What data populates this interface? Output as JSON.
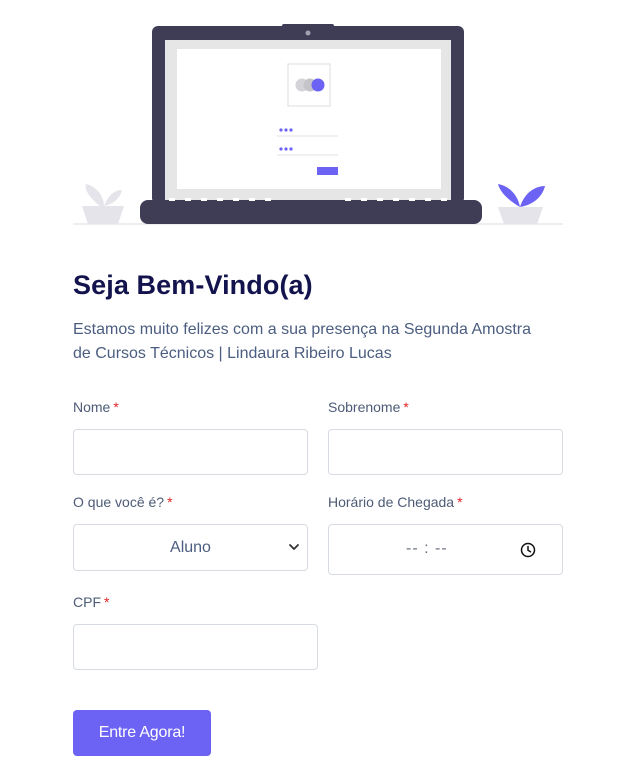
{
  "illustration": {
    "name": "laptop-login-illustration",
    "accent_color": "#6c63f5",
    "dark_color": "#3f3d56"
  },
  "header": {
    "title": "Seja Bem-Vindo(a)",
    "subtitle_line1": "Estamos muito felizes com a sua presença na Segunda Amostra",
    "subtitle_line2": "de Cursos Técnicos | Lindaura Ribeiro Lucas"
  },
  "form": {
    "required_marker": "*",
    "nome": {
      "label": "Nome",
      "value": ""
    },
    "sobrenome": {
      "label": "Sobrenome",
      "value": ""
    },
    "tipo": {
      "label": "O que você é?",
      "selected": "Aluno"
    },
    "horario": {
      "label": "Horário de Chegada",
      "placeholder": "-- : --"
    },
    "cpf": {
      "label": "CPF",
      "value": ""
    },
    "submit_label": "Entre Agora!"
  },
  "colors": {
    "primary": "#6c63f5",
    "title": "#13134d",
    "required": "#e02424"
  }
}
